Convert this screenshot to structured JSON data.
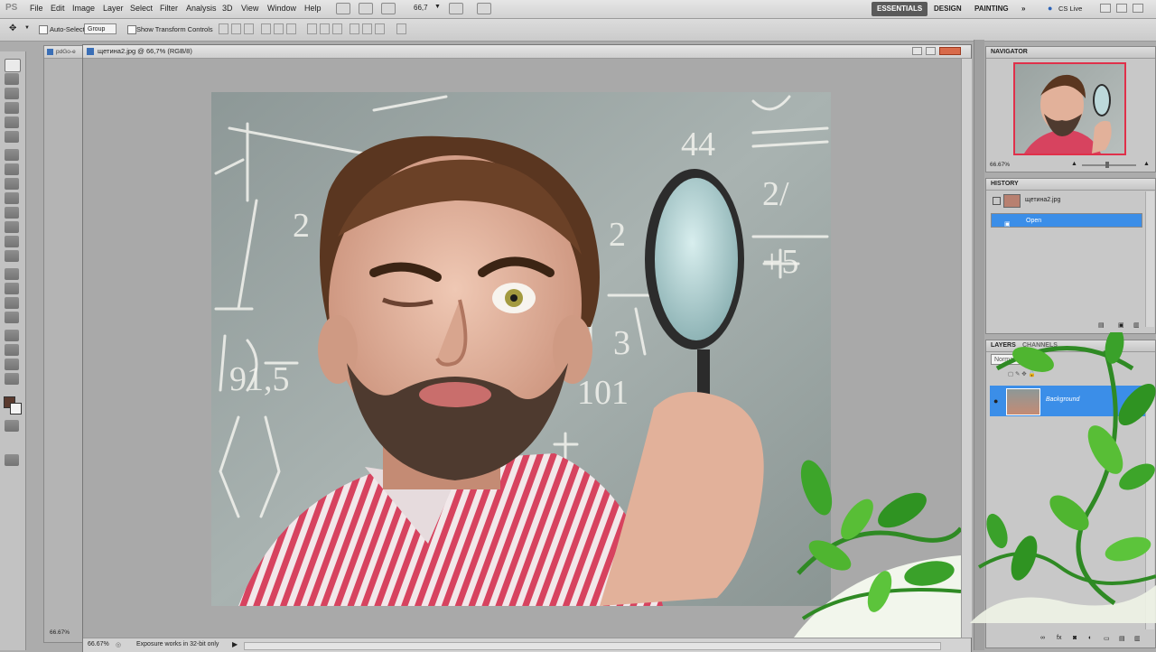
{
  "app": {
    "logo": "PS"
  },
  "menu": [
    "File",
    "Edit",
    "Image",
    "Layer",
    "Select",
    "Filter",
    "Analysis",
    "3D",
    "View",
    "Window",
    "Help"
  ],
  "zoom_select": "66,7",
  "workspaces": {
    "essentials": "ESSENTIALS",
    "design": "DESIGN",
    "painting": "PAINTING",
    "more": "»",
    "cslive": "CS Live"
  },
  "options": {
    "auto_select": "Auto-Select:",
    "auto_select_value": "Group",
    "show_transform": "Show Transform Controls"
  },
  "background_tab": {
    "title": "pdGo-e"
  },
  "document": {
    "title": "щетина2.jpg @ 66,7% (RGB/8)",
    "zoom": "66.67%",
    "status": "Exposure works in 32-bit only"
  },
  "background_doc_zoom": "66.67%",
  "navigator": {
    "title": "NAVIGATOR",
    "zoom": "66.67%"
  },
  "history": {
    "title": "HISTORY",
    "snapshot": "щетина2.jpg",
    "step": "Open"
  },
  "layers": {
    "tab_layers": "LAYERS",
    "tab_channels": "CHANNELS",
    "blend": "Normal",
    "layer_name": "Background"
  },
  "colors": {
    "selection": "#3b8ee8",
    "workspace_active": "#5a5a5a"
  }
}
